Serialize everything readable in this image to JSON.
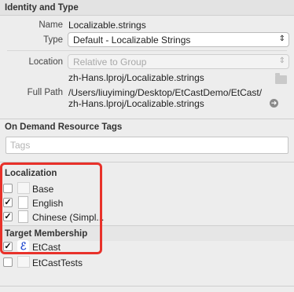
{
  "identity": {
    "header": "Identity and Type",
    "name_label": "Name",
    "name_value": "Localizable.strings",
    "type_label": "Type",
    "type_value": "Default - Localizable Strings",
    "location_label": "Location",
    "location_value": "Relative to Group",
    "location_path": "zh-Hans.lproj/Localizable.strings",
    "fullpath_label": "Full Path",
    "fullpath_line1": "/Users/liuyiming/Desktop/EtCastDemo/EtCast/",
    "fullpath_line2": "zh-Hans.lproj/Localizable.strings"
  },
  "on_demand": {
    "header": "On Demand Resource Tags",
    "tags_placeholder": "Tags"
  },
  "localization": {
    "header": "Localization",
    "items": [
      {
        "label": "Base",
        "checked": false
      },
      {
        "label": "English",
        "checked": true
      },
      {
        "label": "Chinese (Simpl...",
        "checked": true
      }
    ]
  },
  "target_membership": {
    "header": "Target Membership",
    "items": [
      {
        "label": "EtCast",
        "checked": true
      },
      {
        "label": "EtCastTests",
        "checked": false
      }
    ]
  },
  "highlight_color": "#e8312a"
}
